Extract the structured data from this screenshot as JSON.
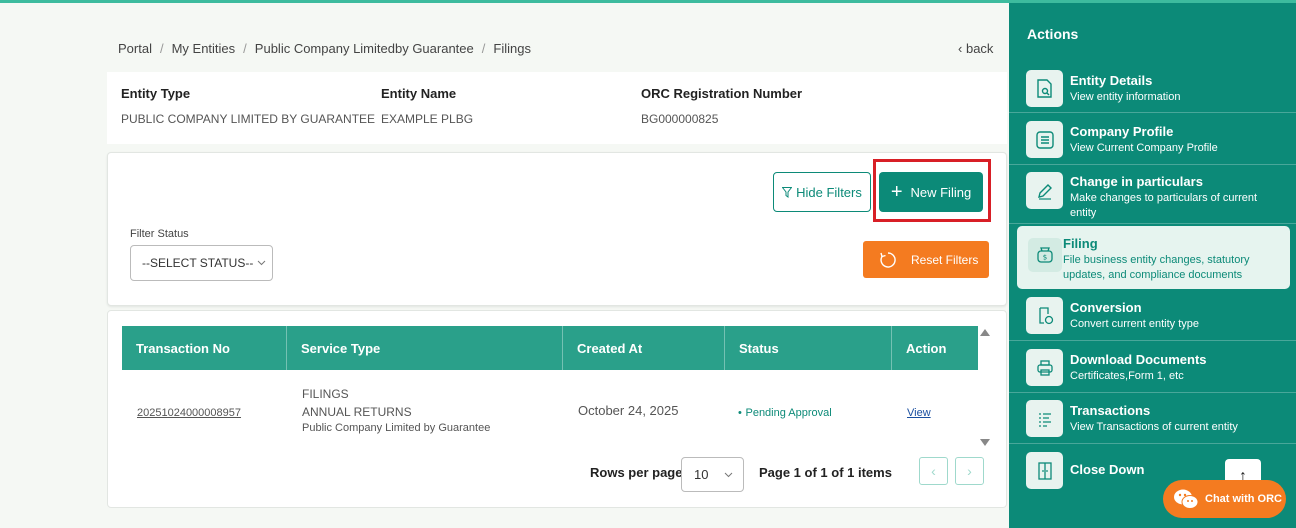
{
  "breadcrumb": {
    "items": [
      "Portal",
      "My Entities",
      "Public Company Limitedby Guarantee",
      "Filings"
    ],
    "separator": "/"
  },
  "back_label": "back",
  "entity": {
    "type_label": "Entity Type",
    "type_value": "PUBLIC COMPANY LIMITED BY GUARANTEE",
    "name_label": "Entity Name",
    "name_value": "EXAMPLE PLBG",
    "orc_label": "ORC Registration Number",
    "orc_value": "BG000000825"
  },
  "filters": {
    "hide_label": "Hide Filters",
    "new_filing_label": "New Filing",
    "status_label": "Filter Status",
    "status_select": "--SELECT STATUS--",
    "reset_label": "Reset Filters"
  },
  "table": {
    "columns": [
      "Transaction No",
      "Service Type",
      "Created At",
      "Status",
      "Action"
    ],
    "rows": [
      {
        "transaction_no": "20251024000008957",
        "service_line1": "FILINGS",
        "service_line2": "ANNUAL RETURNS",
        "service_line3": "Public Company Limited by Guarantee",
        "created_at": "October 24, 2025",
        "status": "Pending Approval",
        "action": "View"
      }
    ],
    "rows_per_page_label": "Rows per page",
    "rows_per_page": "10",
    "page_info": "Page 1 of 1 of 1 items"
  },
  "sidebar": {
    "title": "Actions",
    "items": [
      {
        "title": "Entity Details",
        "desc": "View entity information",
        "icon": "file-search-icon"
      },
      {
        "title": "Company Profile",
        "desc": "View Current Company Profile",
        "icon": "list-icon"
      },
      {
        "title": "Change in particulars",
        "desc": "Make changes to particulars of current entity",
        "icon": "pencil-icon"
      },
      {
        "title": "Filing",
        "desc": "File business entity changes, statutory updates, and compliance documents",
        "icon": "money-bag-icon"
      },
      {
        "title": "Conversion",
        "desc": "Convert current entity type",
        "icon": "convert-icon"
      },
      {
        "title": "Download Documents",
        "desc": "Certificates,Form 1, etc",
        "icon": "printer-icon"
      },
      {
        "title": "Transactions",
        "desc": "View Transactions of current entity",
        "icon": "transactions-icon"
      },
      {
        "title": "Close Down",
        "desc": "",
        "icon": "door-icon"
      }
    ],
    "chat_label": "Chat with ORC"
  },
  "colors": {
    "primary": "#0c8a78",
    "table_header": "#2aa08a",
    "accent_orange": "#f47b20",
    "highlight_red": "#d81f26"
  }
}
